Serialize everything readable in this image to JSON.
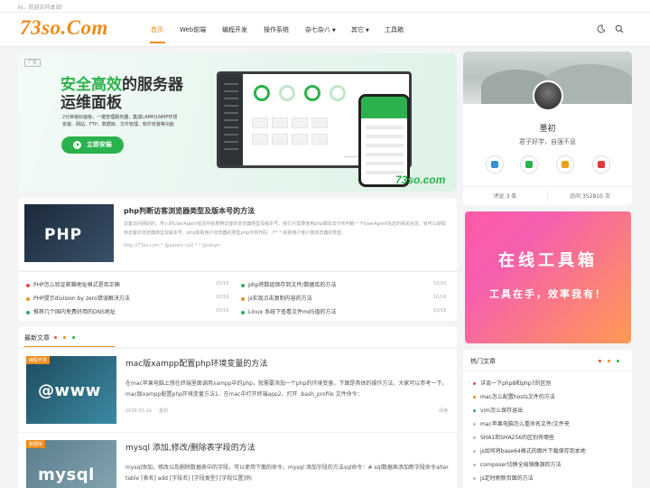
{
  "topbar": {
    "greeting": "hi，欢迎访问本站!"
  },
  "header": {
    "logo": "73so.Com",
    "nav": [
      {
        "label": "首页",
        "active": true,
        "caret": ""
      },
      {
        "label": "Web前端",
        "active": false,
        "caret": ""
      },
      {
        "label": "编程开发",
        "active": false,
        "caret": ""
      },
      {
        "label": "操作系统",
        "active": false,
        "caret": ""
      },
      {
        "label": "杂七杂八",
        "active": false,
        "caret": "▼"
      },
      {
        "label": "其它",
        "active": false,
        "caret": "▼"
      },
      {
        "label": "工具箱",
        "active": false,
        "caret": ""
      }
    ],
    "icons": [
      "moon-icon",
      "search-icon"
    ]
  },
  "banner": {
    "ad_label": "广告",
    "title_highlight": "安全高效",
    "title_rest": "的服务器",
    "title_line2": "运维面板",
    "desc": "2分钟装好面板，一键管理服务器，集成LAMP/LNMP环境安装、网站、FTP、数据库、文件管理、软件安装等功能",
    "button": "立即安装",
    "brand": "73so.com"
  },
  "featured": {
    "thumb_text": "PHP",
    "title": "php判断访客浏览器类型及版本号的方法",
    "excerpt": "访客访问网站时，传入的UserAgent信息中就携带访客的浏览器类型及版本号。我们只需要使用php脚本去分析判断一下UserAgent信息的相关信息，就可以获取到访客的浏览器类型及版本号。php获取用户浏览器的类型php示例代码：/** * 获取用户客户端浏览器的类型",
    "meta": "http://73so.com * @param null * * @return"
  },
  "quick_links": [
    {
      "text": "PHP怎么验证邮箱地址格式是否正确",
      "date": "10/19",
      "color": "#e74c3c"
    },
    {
      "text": "php将数组保存到文件/数据库的方法",
      "date": "10/20",
      "color": "#27ae60"
    },
    {
      "text": "PHP提示division by zero错误解决方法",
      "date": "10/19",
      "color": "#f08c1a"
    },
    {
      "text": "js实现点击复制内容的方法",
      "date": "10/18",
      "color": "#f08c1a"
    },
    {
      "text": "推荐几个国内免费好用的DNS地址",
      "date": "10/19",
      "color": "#27ae60"
    },
    {
      "text": "Linux 系统下查看文件md5值的方法",
      "date": "10/16",
      "color": "#27ae60"
    }
  ],
  "latest": {
    "heading": "最新文章",
    "articles": [
      {
        "tag": "编程开发",
        "thumb_text": "@www",
        "title": "mac版xampp配置php环境变量的方法",
        "excerpt": "在mac苹果电脑上想在终端里面调用xampp中的php，就需要添加一个php的环境变量，下面是具体的操作方法，大家可以参考一下。mac版xampp配置php环境变量方法1、在mac中打开终端app2、打开 .bash_profile 文件命令：",
        "date": "2024-03-10",
        "author": "墨初",
        "read": "阅读"
      },
      {
        "tag": "数据库",
        "thumb_text": "mysql",
        "title": "mysql 添加,修改/删除表字段的方法",
        "excerpt": "mysql添加，修改以及删除数据表中的字段，可以使用下面的命令。mysql 添加字段的方法sql命令：# sql数据表添加新字段命令alter table [表名] add [字段名] [字段类型] [字段位置]例:"
      }
    ]
  },
  "profile": {
    "name": "墨初",
    "motto": "君子好学，自强不息",
    "social": [
      {
        "name": "home-icon",
        "color": "#3a8fd6"
      },
      {
        "name": "wechat-icon",
        "color": "#2bb24c"
      },
      {
        "name": "message-icon",
        "color": "#f0a020"
      },
      {
        "name": "mail-icon",
        "color": "#e03a3a"
      }
    ],
    "comments": "评论 3 条",
    "visits": "访问 352810 次"
  },
  "toolbox": {
    "line1": "在线工具箱",
    "line2": "工具在手，效率我有！"
  },
  "hot": {
    "heading": "热门文章",
    "items": [
      {
        "text": "详谈一下php8和php7的区别",
        "color": "#e74c3c"
      },
      {
        "text": "mac怎么配置hosts文件的方法",
        "color": "#f08c1a"
      },
      {
        "text": "vim怎么保存退出",
        "color": "#27ae60"
      },
      {
        "text": "mac苹果电脑怎么重命名文件/文件夹",
        "color": "#bbbbbb"
      },
      {
        "text": "SHA1和SHA256的区别有哪些",
        "color": "#bbbbbb"
      },
      {
        "text": "js如何将base64格式的图片下载保存到本地",
        "color": "#bbbbbb"
      },
      {
        "text": "composer切换全局镜像源的方法",
        "color": "#bbbbbb"
      },
      {
        "text": "js定时刷新页面的方法",
        "color": "#bbbbbb"
      }
    ]
  },
  "colors": {
    "accent": "#f08c1a",
    "green": "#2bb24c"
  }
}
